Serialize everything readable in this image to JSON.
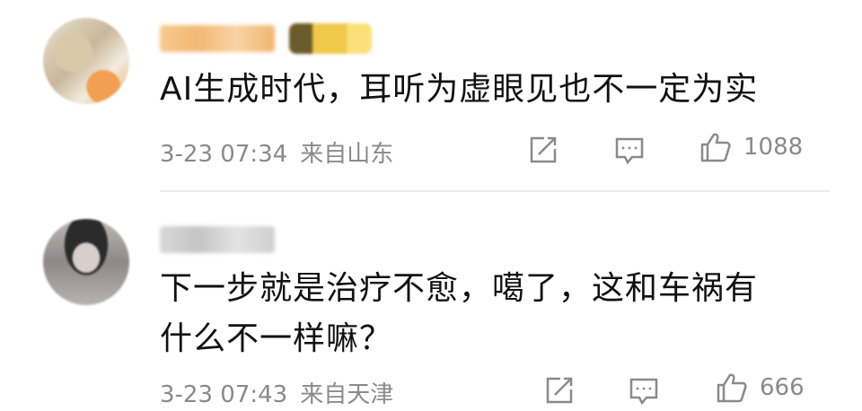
{
  "comments": [
    {
      "text": "AI生成时代，耳听为虚眼见也不一定为实",
      "time": "3-23 07:34",
      "location": "来自山东",
      "likes": "1088"
    },
    {
      "text": "下一步就是治疗不愈，噶了，这和车祸有什么不一样嘛？",
      "time": "3-23 07:43",
      "location": "来自天津",
      "likes": "666"
    }
  ],
  "icons": [
    "share-icon",
    "reply-icon",
    "like-icon"
  ],
  "colors": {
    "text": "#111111",
    "meta": "#8a8a8a",
    "divider": "#ececec"
  }
}
